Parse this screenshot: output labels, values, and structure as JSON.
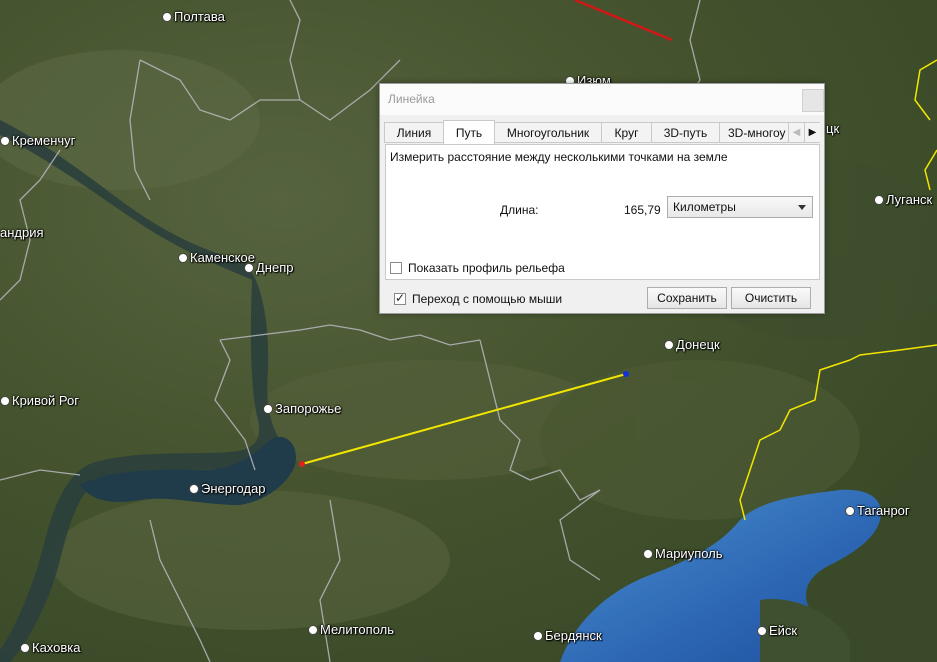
{
  "map": {
    "cities": [
      {
        "id": "poltava",
        "name": "Полтава"
      },
      {
        "id": "izyum",
        "name": "Изюм"
      },
      {
        "id": "kremenchug",
        "name": "Кременчуг"
      },
      {
        "id": "aleksandriya",
        "name": "андрия"
      },
      {
        "id": "kamenskoe",
        "name": "Каменское"
      },
      {
        "id": "dnepr",
        "name": "Днепр"
      },
      {
        "id": "krivoy-rog",
        "name": "Кривой Рог"
      },
      {
        "id": "zaporozhye",
        "name": "Запорожье"
      },
      {
        "id": "energodar",
        "name": "Энергодар"
      },
      {
        "id": "donetsk",
        "name": "Донецк"
      },
      {
        "id": "lugansk",
        "name": "Луганск"
      },
      {
        "id": "taganrog",
        "name": "Таганрог"
      },
      {
        "id": "mariupol",
        "name": "Мариуполь"
      },
      {
        "id": "berdyansk",
        "name": "Бердянск"
      },
      {
        "id": "eysk",
        "name": "Ейск"
      },
      {
        "id": "melitopol",
        "name": "Мелитополь"
      },
      {
        "id": "kakhovka",
        "name": "Каховка"
      },
      {
        "id": "partial-tsk",
        "name": "цк"
      }
    ]
  },
  "ruler": {
    "title": "Линейка",
    "tabs": [
      "Линия",
      "Путь",
      "Многоугольник",
      "Круг",
      "3D-путь",
      "3D-многоу"
    ],
    "active_tab": "Путь",
    "description": "Измерить расстояние между несколькими точками на земле",
    "length_label": "Длина:",
    "length_value": "165,79",
    "unit": "Километры",
    "show_profile_label": "Показать профиль рельефа",
    "show_profile_checked": false,
    "mouse_nav_label": "Переход с помощью мыши",
    "mouse_nav_checked": true,
    "save_label": "Сохранить",
    "clear_label": "Очистить"
  },
  "colors": {
    "path_line": "#f2e600",
    "start_point": "#e02020",
    "end_point": "#1030e0",
    "border_line": "#f2e600",
    "red_line": "#d01818"
  }
}
